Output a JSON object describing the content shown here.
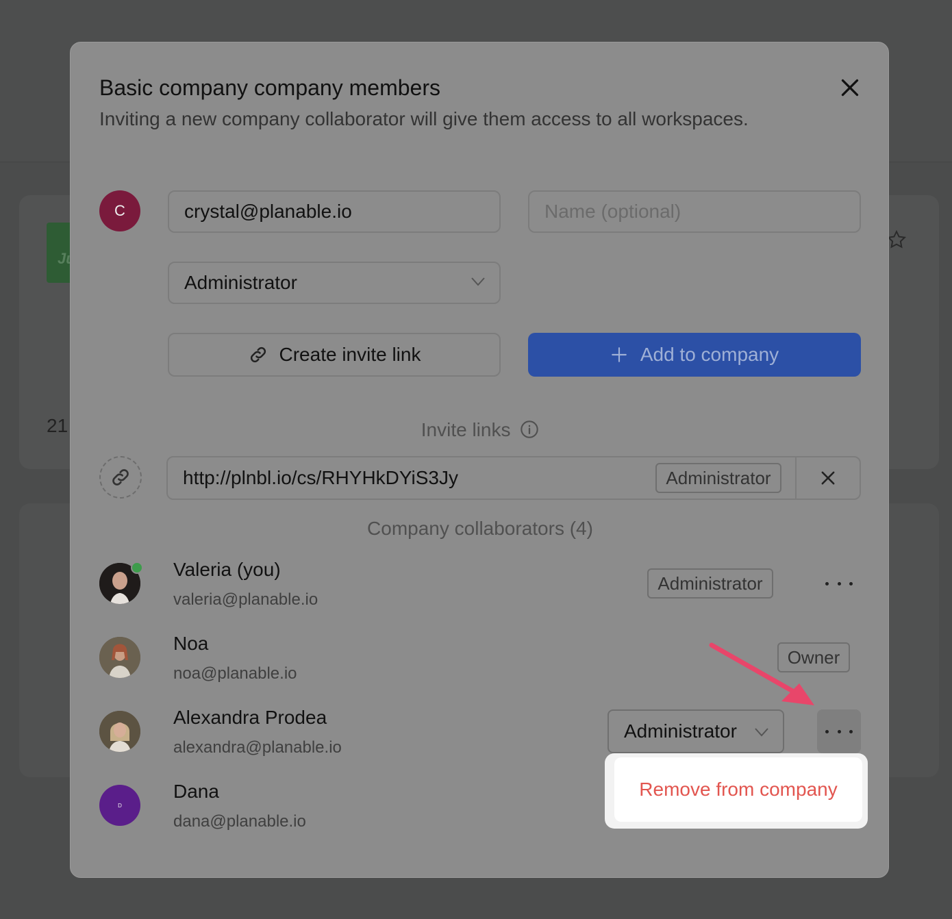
{
  "background": {
    "thumb_text": "Ju",
    "card_number": "21"
  },
  "modal": {
    "title": "Basic company company members",
    "subtitle": "Inviting a new company collaborator will give them access to all workspaces.",
    "invite_form": {
      "avatar_letter": "C",
      "avatar_color": "#7a1a3c",
      "email_value": "crystal@planable.io",
      "name_placeholder": "Name (optional)",
      "role_value": "Administrator",
      "create_link_label": "Create invite link",
      "add_button_label": "Add to company",
      "primary_color": "#2c50a6"
    },
    "invite_links": {
      "heading": "Invite links",
      "links": [
        {
          "url": "http://plnbl.io/cs/RHYHkDYiS3Jy",
          "role": "Administrator"
        }
      ]
    },
    "collaborators": {
      "heading": "Company collaborators (4)",
      "members": [
        {
          "name": "Valeria (you)",
          "email": "valeria@planable.io",
          "role": "Administrator",
          "online": true
        },
        {
          "name": "Noa",
          "email": "noa@planable.io",
          "role": "Owner"
        },
        {
          "name": "Alexandra Prodea",
          "email": "alexandra@planable.io",
          "role": "Administrator"
        },
        {
          "name": "Dana",
          "email": "dana@planable.io",
          "avatar_letter": "D",
          "avatar_color": "#5a1e8a"
        }
      ]
    },
    "context_menu": {
      "items": [
        {
          "label": "Remove from company",
          "color": "#e2554f"
        }
      ]
    },
    "annotation_arrow_color": "#e8466a"
  }
}
